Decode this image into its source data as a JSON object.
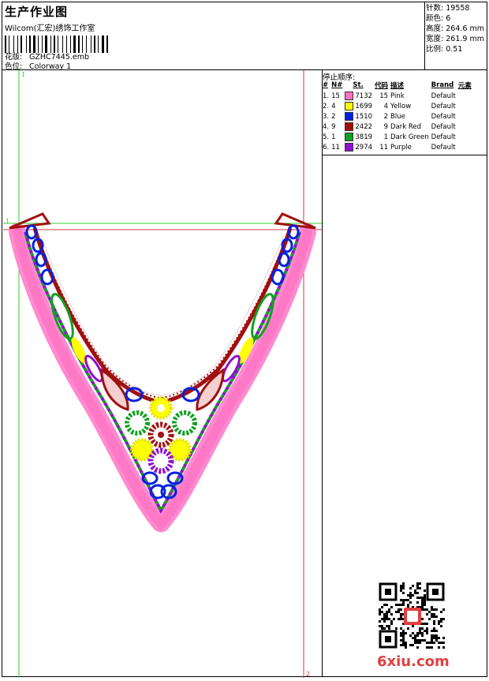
{
  "header": {
    "title": "生产作业图",
    "company": "Wilcom(汇宏)绣饰工作室",
    "design_label": "花版:",
    "design_value": "GZHC7445.emb",
    "colorway_label": "色位:",
    "colorway_value": "Colorway 1"
  },
  "specs": [
    {
      "label": "针数:",
      "value": "19558"
    },
    {
      "label": "颜色:",
      "value": "6"
    },
    {
      "label": "高度:",
      "value": "264.6 mm"
    },
    {
      "label": "宽度:",
      "value": "261.9 mm"
    },
    {
      "label": "比例:",
      "value": "0.51"
    }
  ],
  "stop_sequence": {
    "title": "停止顺序:",
    "columns": [
      "#",
      "N#",
      "St.",
      "代码",
      "描述",
      "Brand",
      "元素"
    ],
    "rows": [
      {
        "idx": "1.",
        "n": "15",
        "color": "#ff70c0",
        "code": "7132",
        "st": "15",
        "desc": "Pink",
        "brand": "Default"
      },
      {
        "idx": "2.",
        "n": "4",
        "color": "#ffff00",
        "code": "1699",
        "st": "4",
        "desc": "Yellow",
        "brand": "Default"
      },
      {
        "idx": "3.",
        "n": "2",
        "color": "#0020e0",
        "code": "1510",
        "st": "2",
        "desc": "Blue",
        "brand": "Default"
      },
      {
        "idx": "4.",
        "n": "9",
        "color": "#a01010",
        "code": "2422",
        "st": "9",
        "desc": "Dark Red",
        "brand": "Default"
      },
      {
        "idx": "5.",
        "n": "1",
        "color": "#10a020",
        "code": "3819",
        "st": "1",
        "desc": "Dark Green",
        "brand": "Default"
      },
      {
        "idx": "6.",
        "n": "11",
        "color": "#9010d0",
        "code": "2974",
        "st": "11",
        "desc": "Purple",
        "brand": "Default"
      }
    ]
  },
  "guides": {
    "green_label": "1",
    "green_label_2": "1",
    "red_label": "2"
  },
  "watermark": "6xiu.com"
}
